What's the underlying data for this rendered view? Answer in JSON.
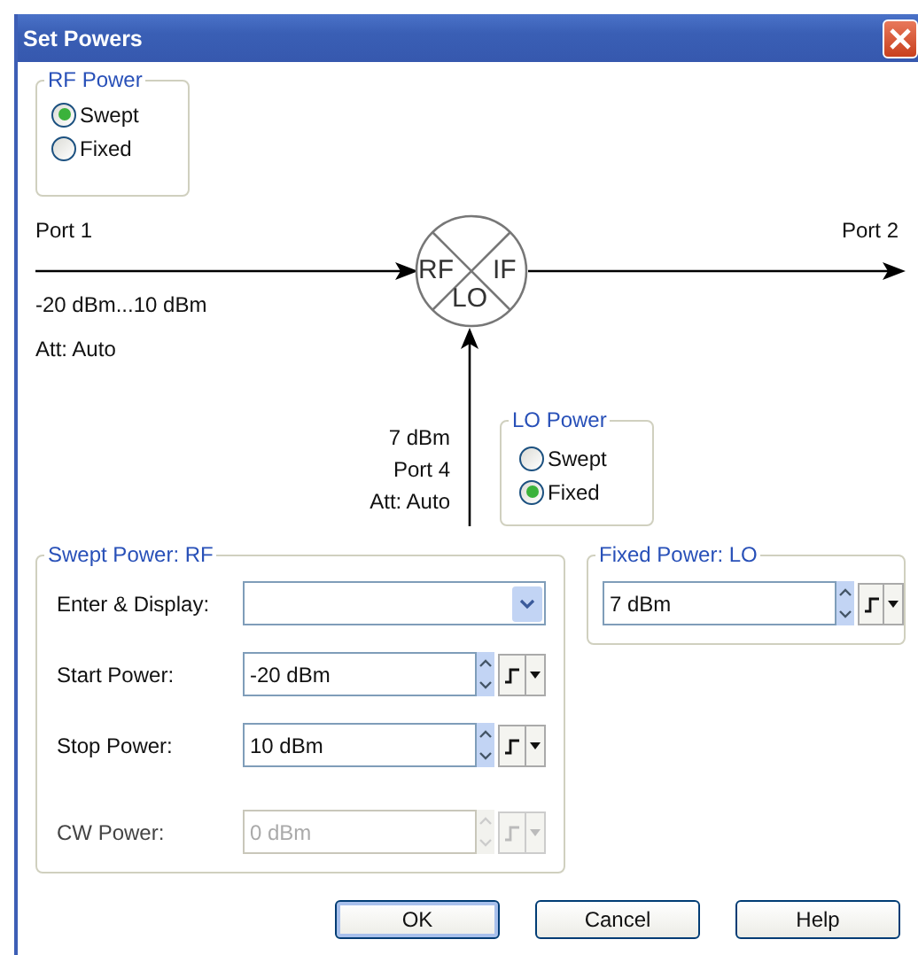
{
  "window": {
    "title": "Set Powers"
  },
  "rf_power": {
    "title": "RF Power",
    "options": [
      {
        "label": "Swept",
        "selected": true
      },
      {
        "label": "Fixed",
        "selected": false
      }
    ]
  },
  "diagram": {
    "input_port": "Port 1",
    "output_port": "Port 2",
    "rf_range": "-20 dBm...10 dBm",
    "rf_attenuation": "Att: Auto",
    "mixer": {
      "rf": "RF",
      "if": "IF",
      "lo": "LO"
    },
    "lo_level": "7 dBm",
    "lo_port": "Port 4",
    "lo_attenuation": "Att: Auto"
  },
  "lo_power": {
    "title": "LO Power",
    "options": [
      {
        "label": "Swept",
        "selected": false
      },
      {
        "label": "Fixed",
        "selected": true
      }
    ]
  },
  "swept_power": {
    "title": "Swept Power: RF",
    "rows": [
      {
        "label": "Enter & Display:",
        "kind": "dropdown"
      },
      {
        "label": "Start Power:",
        "kind": "spin",
        "value": "-20 dBm",
        "disabled": false
      },
      {
        "label": "Stop Power:",
        "kind": "spin",
        "value": "10 dBm",
        "disabled": false
      },
      {
        "label": "CW Power:",
        "kind": "spin",
        "value": "0 dBm",
        "disabled": true
      }
    ]
  },
  "fixed_power": {
    "title": "Fixed Power: LO",
    "value": "7 dBm",
    "disabled": false
  },
  "buttons": [
    {
      "label": "OK",
      "default": true
    },
    {
      "label": "Cancel",
      "default": false
    },
    {
      "label": "Help",
      "default": false
    }
  ]
}
